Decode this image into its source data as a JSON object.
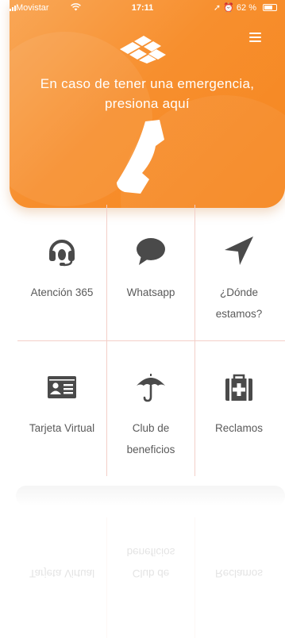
{
  "status_bar": {
    "carrier": "Movistar",
    "time": "17:11",
    "battery": "62 %"
  },
  "hero": {
    "headline_line1": "En caso de tener una emergencia,",
    "headline_line2": "presiona aquí",
    "logo_icon": "company-logo",
    "phone_icon": "phone-icon",
    "menu_icon": "hamburger-menu-icon"
  },
  "grid": {
    "items": [
      {
        "label_line1": "Atención 365",
        "label_line2": "",
        "icon": "headset-icon"
      },
      {
        "label_line1": "Whatsapp",
        "label_line2": "",
        "icon": "chat-bubble-icon"
      },
      {
        "label_line1": "¿Dónde",
        "label_line2": "estamos?",
        "icon": "location-arrow-icon"
      },
      {
        "label_line1": "Tarjeta Virtual",
        "label_line2": "",
        "icon": "id-card-icon"
      },
      {
        "label_line1": "Club de",
        "label_line2": "beneficios",
        "icon": "umbrella-icon"
      },
      {
        "label_line1": "Reclamos",
        "label_line2": "",
        "icon": "medical-kit-icon"
      }
    ]
  },
  "colors": {
    "accent": "#f78f2e",
    "accent_light": "#f9a757",
    "icon": "#4a4a4a",
    "text": "#5a5a5a",
    "divider": "#f3cfc8"
  }
}
